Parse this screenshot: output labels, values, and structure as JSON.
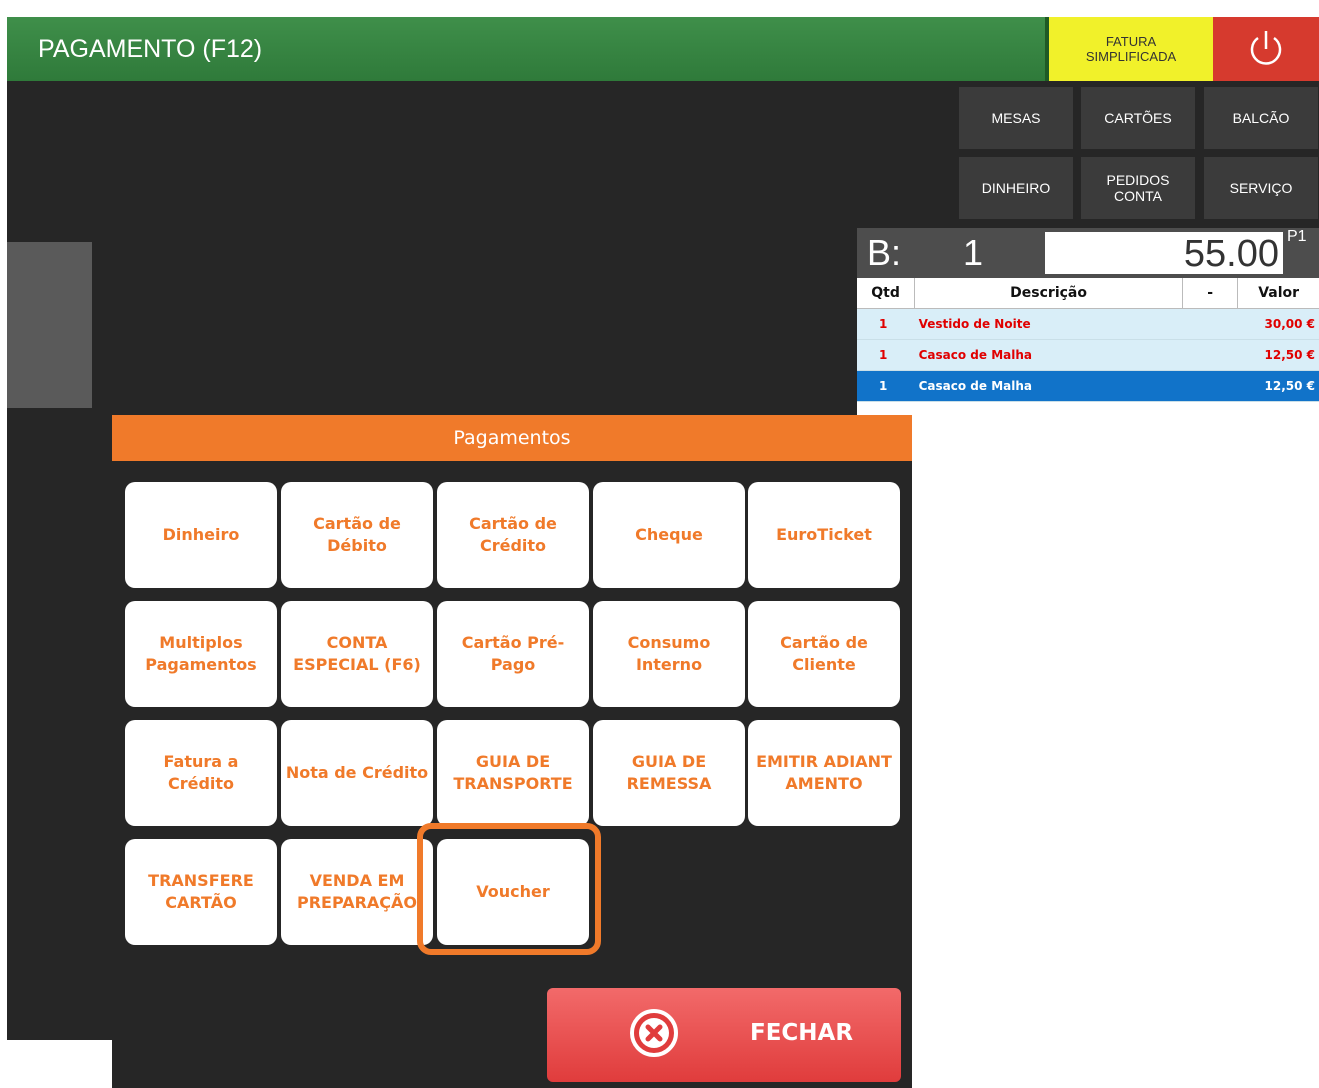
{
  "header": {
    "title": "PAGAMENTO (F12)",
    "fatura_label": "FATURA\nSIMPLIFICADA",
    "power_icon": "power-icon"
  },
  "nav": {
    "mesas": "MESAS",
    "cartoes": "CARTÕES",
    "balcao": "BALCÃO",
    "dinheiro": "DINHEIRO",
    "pedidos": "PEDIDOS CONTA",
    "servico": "SERVIÇO"
  },
  "bill": {
    "label": "B:",
    "number": "1",
    "amount": "55.00",
    "badge": "P1"
  },
  "orders": {
    "headers": [
      "Qtd",
      "Descrição",
      "-",
      "Valor"
    ],
    "rows": [
      {
        "qty": "1",
        "desc": "Vestido de Noite",
        "value": "30,00 €"
      },
      {
        "qty": "1",
        "desc": "Casaco de Malha",
        "value": "12,50 €"
      },
      {
        "qty": "1",
        "desc": "Casaco de Malha",
        "value": "12,50 €"
      }
    ]
  },
  "dialog": {
    "title": "Pagamentos",
    "buttons": [
      "Dinheiro",
      "Cartão de Débito",
      "Cartão de Crédito",
      "Cheque",
      "EuroTicket",
      "Multiplos Pagamentos",
      "CONTA ESPECIAL (F6)",
      "Cartão Pré-Pago",
      "Consumo Interno",
      "Cartão de Cliente",
      "Fatura a Crédito",
      "Nota de Crédito",
      "GUIA DE TRANSPORTE",
      "GUIA DE REMESSA",
      "EMITIR ADIANTAMENTO",
      "TRANSFERE CARTÃO",
      "VENDA EM PREPARAÇÃO",
      "Voucher"
    ],
    "close_label": "FECHAR"
  },
  "colors": {
    "accent": "#f07a2a",
    "header_green": "#3f8f4a",
    "close_red": "#e03c3c",
    "selected_row": "#1173c9"
  }
}
